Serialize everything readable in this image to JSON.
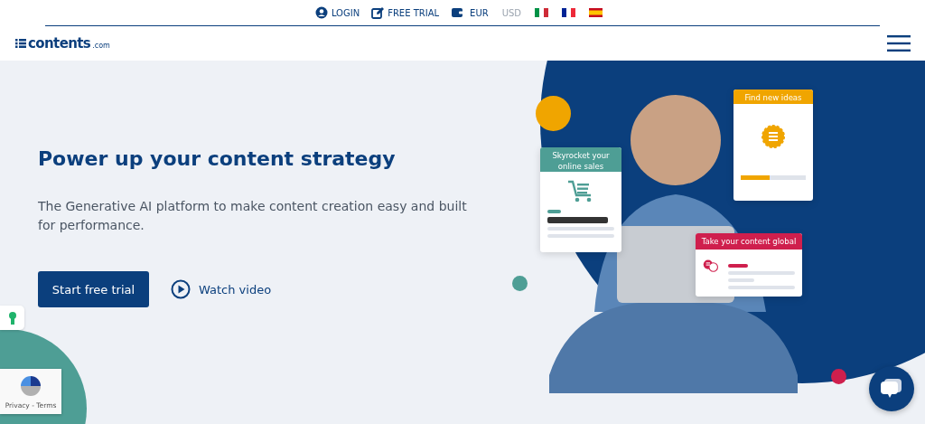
{
  "top_bar": {
    "links": [
      {
        "kind": "login",
        "label": "LOGIN"
      },
      {
        "kind": "trial",
        "label": "FREE TRIAL"
      }
    ],
    "currencies": [
      {
        "label": "EUR",
        "selected": true
      },
      {
        "label": "USD",
        "selected": false
      }
    ],
    "languages": [
      {
        "kind": "it"
      },
      {
        "kind": "fr"
      },
      {
        "kind": "es"
      }
    ]
  },
  "logo": {
    "name": "contents",
    "suffix": ".com"
  },
  "hero": {
    "title": "Power up your content strategy",
    "subtitle": "The Generative AI platform to make content creation easy and built for performance.",
    "primary_button": "Start free trial",
    "video_link": "Watch video"
  },
  "feature_cards": [
    {
      "kind": "sales",
      "title": "Skyrocket your online sales",
      "color": "#4e9e95"
    },
    {
      "kind": "ideas",
      "title": "Find new ideas",
      "color": "#f0a500",
      "level": 0.45
    },
    {
      "kind": "global",
      "title": "Take your content global",
      "color": "#cf1f4d"
    }
  ],
  "recaptcha": {
    "links": "Privacy - Terms"
  }
}
